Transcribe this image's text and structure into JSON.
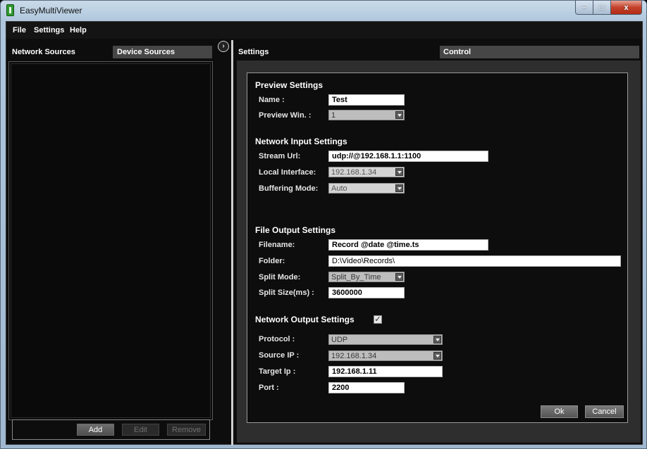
{
  "window": {
    "title": "EasyMultiViewer",
    "minimize": "–",
    "maximize": "□",
    "close": "x"
  },
  "menu": [
    "File",
    "Settings",
    "Help"
  ],
  "left": {
    "tabs": [
      "Network Sources",
      "Device Sources"
    ],
    "buttons": {
      "add": "Add",
      "edit": "Edit",
      "remove": "Remove"
    }
  },
  "right": {
    "tabs": [
      "Settings",
      "Control"
    ],
    "preview": {
      "title": "Preview Settings",
      "name_label": "Name :",
      "name_value": "Test",
      "win_label": "Preview Win. :",
      "win_value": "1"
    },
    "network_input": {
      "title": "Network Input Settings",
      "url_label": "Stream Url:",
      "url_value": "udp://@192.168.1.1:1100",
      "iface_label": "Local Interface:",
      "iface_value": "192.168.1.34",
      "buffer_label": "Buffering Mode:",
      "buffer_value": "Auto"
    },
    "file_output": {
      "title": "File Output Settings",
      "filename_label": "Filename:",
      "filename_value": "Record @date @time.ts",
      "folder_label": "Folder:",
      "folder_value": "D:\\Video\\Records\\",
      "split_mode_label": "Split Mode:",
      "split_mode_value": "Split_By_Time",
      "split_size_label": "Split Size(ms) :",
      "split_size_value": "3600000"
    },
    "network_output": {
      "title": "Network Output Settings",
      "enabled": "✓",
      "protocol_label": "Protocol :",
      "protocol_value": "UDP",
      "source_ip_label": "Source IP :",
      "source_ip_value": "192.168.1.34",
      "target_ip_label": "Target Ip :",
      "target_ip_value": "192.168.1.11",
      "port_label": "Port :",
      "port_value": "2200"
    },
    "buttons": {
      "ok": "Ok",
      "cancel": "Cancel"
    }
  }
}
